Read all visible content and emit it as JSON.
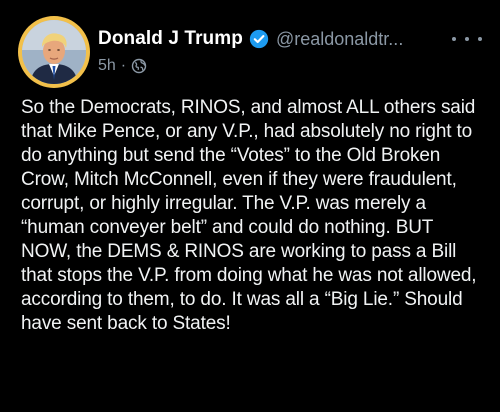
{
  "author": {
    "name": "Donald J Trump",
    "handle": "@realdonaldtr...",
    "verified": true
  },
  "meta": {
    "time": "5h",
    "separator": "·",
    "visibility_icon": "globe-icon"
  },
  "post": {
    "text": "So the Democrats, RINOS, and almost ALL others said that Mike Pence, or any V.P., had absolutely no right to do anything but send the “Votes” to the Old Broken Crow, Mitch McConnell, even if they were fraudulent, corrupt, or highly irregular. The V.P. was merely a “human conveyer belt” and could do nothing. BUT NOW, the DEMS & RINOS are working to pass a Bill that stops the V.P. from doing what he was not allowed, according to them, to do. It was all a “Big Lie.” Should have sent back to States!"
  },
  "icons": {
    "verified": "verified-badge-icon",
    "more": "more-options-icon"
  },
  "colors": {
    "background": "#000000",
    "text": "#f1f3f4",
    "secondary": "#8b98a5",
    "verified_blue": "#1d9bf0",
    "avatar_ring": "#f2c04a"
  }
}
